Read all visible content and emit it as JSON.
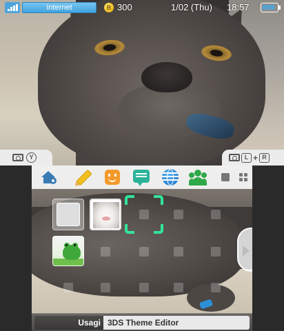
{
  "status_bar": {
    "connection_label": "Internet",
    "coin_symbol": "B",
    "coins": "300",
    "date": "1/02 (Thu)",
    "time": "18:57"
  },
  "top_screen": {
    "screenshot_left_buttons": [
      "Y"
    ],
    "screenshot_right_buttons": [
      "L",
      "+",
      "R"
    ]
  },
  "toolbar": {
    "items": [
      {
        "name": "home-settings",
        "icon": "house-gear-icon",
        "color": "#3b7bb5"
      },
      {
        "name": "notes",
        "icon": "pencil-icon",
        "color": "#f2c021"
      },
      {
        "name": "mii",
        "icon": "smiley-icon",
        "color": "#f39a2b"
      },
      {
        "name": "notifications",
        "icon": "chat-icon",
        "color": "#2bb39a"
      },
      {
        "name": "browser",
        "icon": "globe-icon",
        "color": "#2a82d0"
      },
      {
        "name": "friends",
        "icon": "friends-icon",
        "color": "#2fa84a"
      }
    ],
    "view_toggles": [
      "single-view-icon",
      "grid-view-icon"
    ]
  },
  "bottom_screen": {
    "tiles": [
      "folder",
      "cat photo",
      "empty cursor slot",
      "frog"
    ],
    "cursor_color": "#33e39a",
    "author": "Usagi",
    "theme_title": "3DS Theme Editor"
  }
}
